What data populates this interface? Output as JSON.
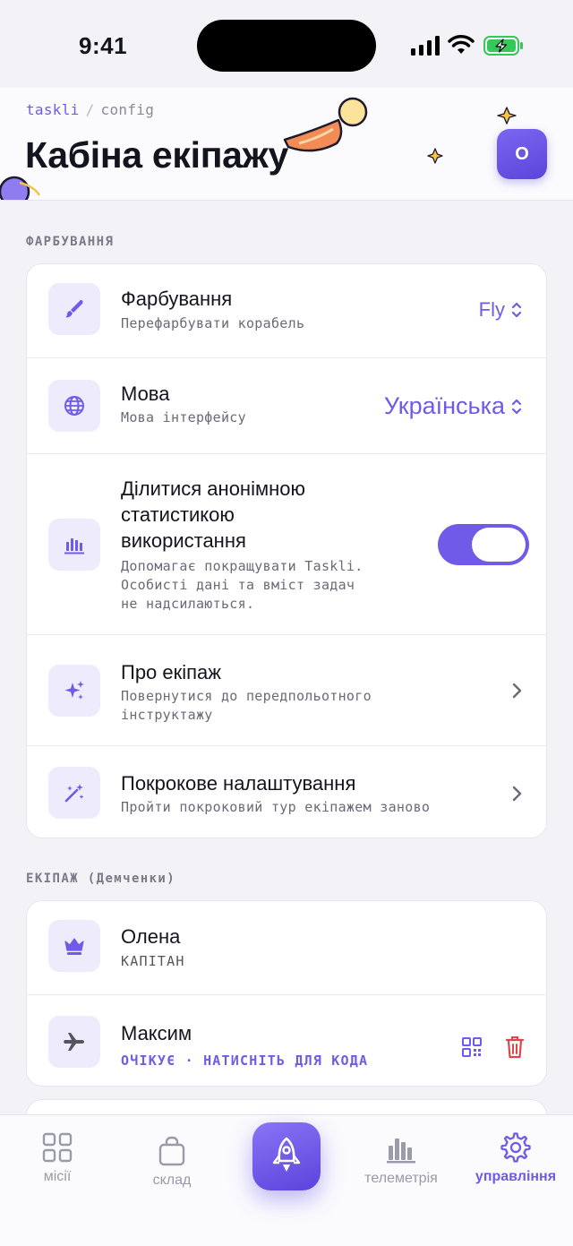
{
  "status_bar": {
    "time": "9:41"
  },
  "header": {
    "breadcrumb_home": "taskli",
    "breadcrumb_sep": "/",
    "breadcrumb_current": "config",
    "title": "Кабіна екіпажу",
    "avatar_initial": "O"
  },
  "section_settings": {
    "label": "ФАРБУВАННЯ",
    "rows": [
      {
        "title": "Фарбування",
        "subtitle": "Перефарбувати корабель",
        "value": "Fly",
        "icon": "paintbrush-icon"
      },
      {
        "title": "Мова",
        "subtitle": "Мова інтерфейсу",
        "value": "Українська",
        "icon": "globe-icon"
      },
      {
        "title_lines": [
          "Ділитися анонімною",
          "статистикою",
          "використання"
        ],
        "subtitle_lines": [
          "Допомагає покращувати Taskli.",
          "Особисті дані та вміст задач",
          "не надсилаються."
        ],
        "toggle_on": true,
        "icon": "bar-chart-icon"
      },
      {
        "title": "Про екіпаж",
        "subtitle_lines": [
          "Повернутися до передпольотного",
          "інструктажу"
        ],
        "icon": "sparkles-icon"
      },
      {
        "title": "Покрокове налаштування",
        "subtitle": "Пройти покроковий тур екіпажем заново",
        "icon": "magic-wand-icon"
      }
    ]
  },
  "section_crew": {
    "label": "ЕКІПАЖ (Демченки)",
    "members": [
      {
        "name": "Олена",
        "role": "КАПІТАН",
        "icon": "crown-icon"
      },
      {
        "name": "Максим",
        "status": "ОЧІКУЄ · НАТИСНІТЬ ДЛЯ КОДА",
        "icon": "plane-icon"
      }
    ]
  },
  "tabbar": {
    "tabs": [
      {
        "label": "місії",
        "icon": "grid-icon"
      },
      {
        "label": "склад",
        "icon": "bag-icon"
      },
      {
        "label": "",
        "icon": "rocket-icon"
      },
      {
        "label": "телеметрія",
        "icon": "bar-chart-icon"
      },
      {
        "label": "управління",
        "icon": "gear-icon",
        "active": true
      }
    ]
  },
  "colors": {
    "accent": "#6f5be8",
    "danger": "#e0454b",
    "background": "#f3f3f7"
  }
}
